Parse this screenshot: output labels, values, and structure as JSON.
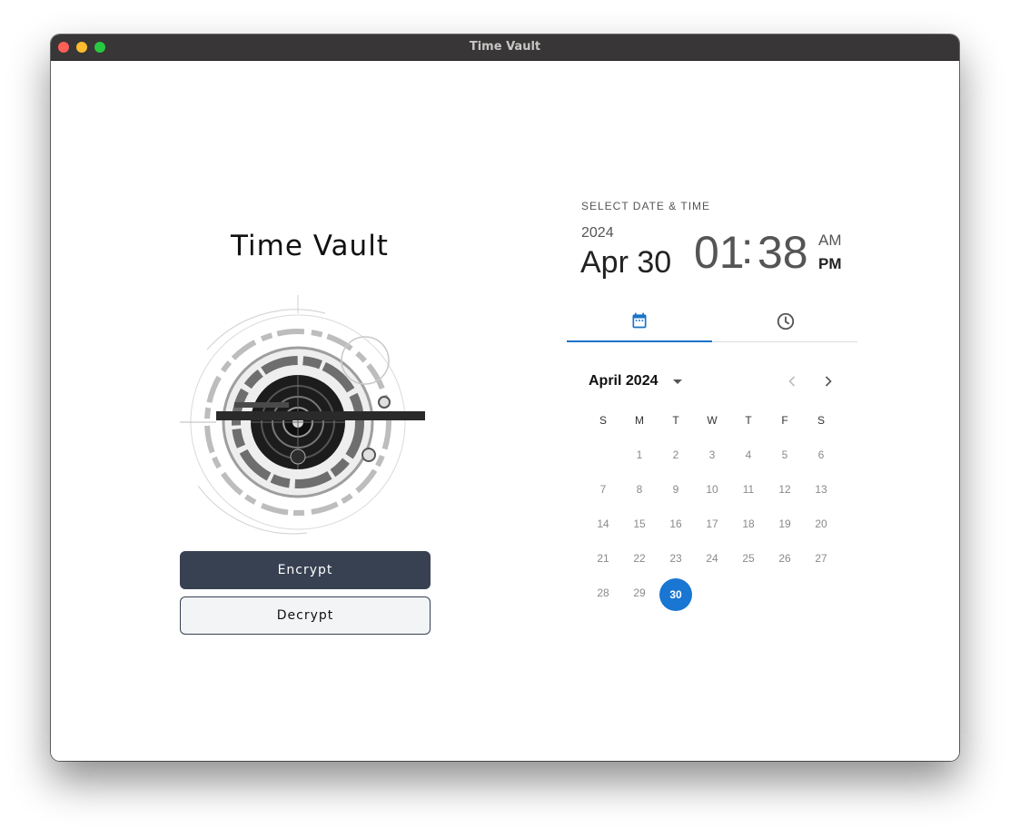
{
  "window": {
    "title": "Time Vault"
  },
  "app": {
    "title": "Time Vault"
  },
  "actions": {
    "encrypt_label": "Encrypt",
    "decrypt_label": "Decrypt"
  },
  "picker": {
    "label": "SELECT DATE & TIME",
    "year": "2024",
    "date": "Apr 30",
    "hour": "01",
    "minute": "38",
    "am": "AM",
    "pm": "PM",
    "selected_meridiem": "PM",
    "tabs": [
      {
        "icon": "calendar-icon",
        "active": true
      },
      {
        "icon": "clock-icon",
        "active": false
      }
    ],
    "month_label": "April 2024",
    "weekdays": [
      "S",
      "M",
      "T",
      "W",
      "T",
      "F",
      "S"
    ],
    "weeks": [
      [
        "",
        "1",
        "2",
        "3",
        "4",
        "5",
        "6"
      ],
      [
        "7",
        "8",
        "9",
        "10",
        "11",
        "12",
        "13"
      ],
      [
        "14",
        "15",
        "16",
        "17",
        "18",
        "19",
        "20"
      ],
      [
        "21",
        "22",
        "23",
        "24",
        "25",
        "26",
        "27"
      ],
      [
        "28",
        "29",
        "30",
        "",
        "",
        "",
        ""
      ]
    ],
    "selected_day": "30"
  },
  "colors": {
    "accent": "#1976d2",
    "encrypt_bg": "#374151",
    "decrypt_bg": "#f3f4f6"
  }
}
